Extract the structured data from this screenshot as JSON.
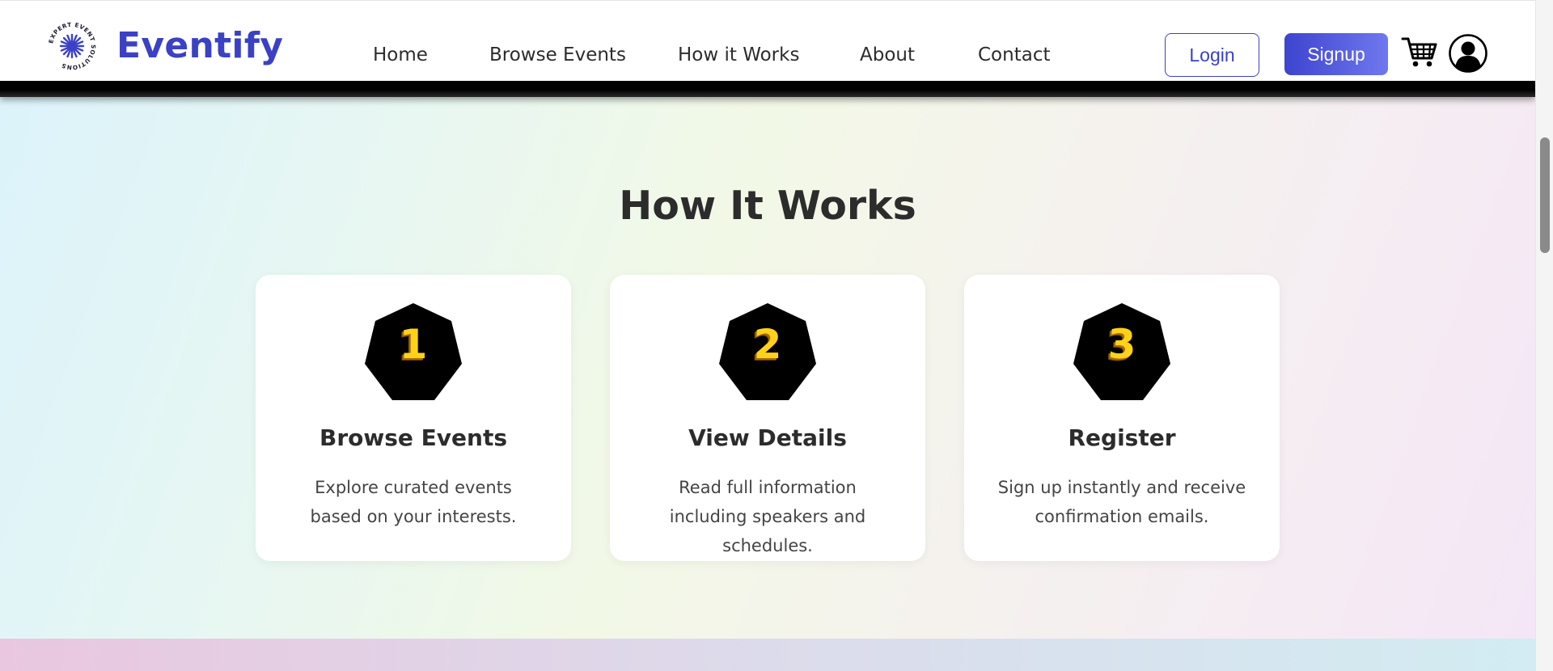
{
  "header": {
    "logo_ring_text": "EXPERT EVENT SOLUTIONS",
    "brand": "Eventify",
    "nav": [
      {
        "label": "Home"
      },
      {
        "label": "Browse Events"
      },
      {
        "label": "How it Works"
      },
      {
        "label": "About"
      },
      {
        "label": "Contact"
      }
    ],
    "login_label": "Login",
    "signup_label": "Signup",
    "icons": {
      "cart": "cart-icon",
      "profile": "user-circle-icon",
      "logo": "starburst-logo-icon"
    }
  },
  "how_it_works": {
    "title": "How It Works",
    "cards": [
      {
        "number": "1",
        "title": "Browse Events",
        "description": "Explore curated events based on your interests."
      },
      {
        "number": "2",
        "title": "View Details",
        "description": "Read full information including speakers and schedules."
      },
      {
        "number": "3",
        "title": "Register",
        "description": "Sign up instantly and receive confirmation emails."
      }
    ]
  },
  "colors": {
    "brand": "#3b41c5",
    "signup_gradient_start": "#3d44cf",
    "signup_gradient_end": "#7078ee",
    "number_gold": "#ffd21a",
    "text_dark": "#2c2c2c"
  }
}
